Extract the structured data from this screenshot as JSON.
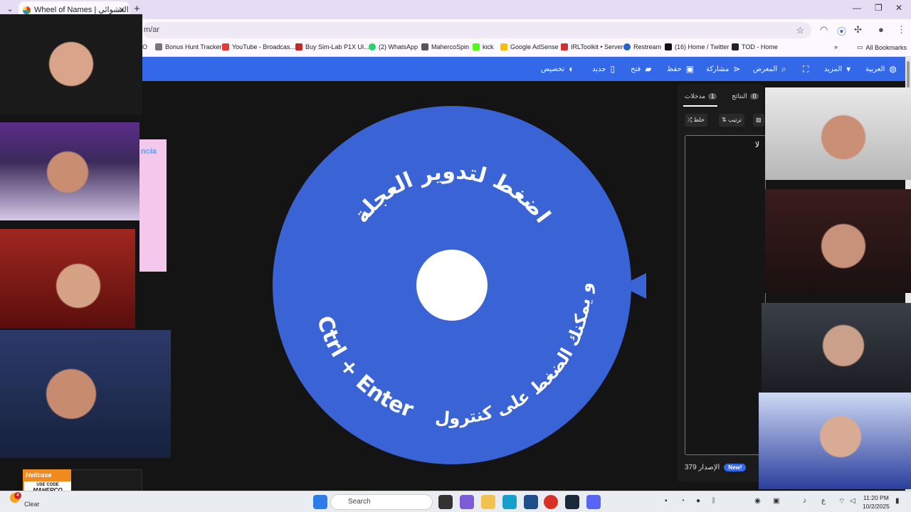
{
  "browser": {
    "tab_title": "Wheel of Names | عجلة الاسم العشوائي",
    "url": "m/ar",
    "bookmarks": [
      "O",
      "Bonus Hunt Tracker",
      "YouTube - Broadcas...",
      "Buy Sim-Lab P1X Ul...",
      "(2) WhatsApp",
      "MahercoSpin",
      "kick",
      "Google AdSense",
      "IRLToolkit • Server",
      "Restream",
      "(16) Home / Twitter",
      "TOD - Home",
      "All Bookmarks"
    ]
  },
  "header": {
    "language": "العربية",
    "more": "المزيد",
    "gallery": "المعرض",
    "share": "مشاركة",
    "save": "حفظ",
    "open": "فتح",
    "new": "جديد",
    "customize": "تخصيص"
  },
  "wheel": {
    "top_text": "اضغط لتدوير العجلة",
    "bottom_text": "أو يمكنك الضغط على كنترول",
    "shortcut": "Ctrl + Enter",
    "color": "#3a63d6"
  },
  "panel": {
    "tab_entries": "مدخلات",
    "entries_count": "1",
    "tab_results": "النتائج",
    "results_count": "0",
    "shuffle": "خلط",
    "sort": "ترتيب",
    "entry_text": "لا",
    "version_label": "الإصدار 379",
    "new_badge": "New!"
  },
  "overlays": {
    "ad_text": "ncia",
    "sponsor_brand": "Hellcase",
    "sponsor_use_code": "USE CODE",
    "sponsor_code": "MAHERCO"
  },
  "taskbar": {
    "weather_badge": "4",
    "weather": "Clear",
    "search_placeholder": "Search",
    "time": "11:20 PM",
    "date": "10/2/2025",
    "lang": "ع"
  }
}
